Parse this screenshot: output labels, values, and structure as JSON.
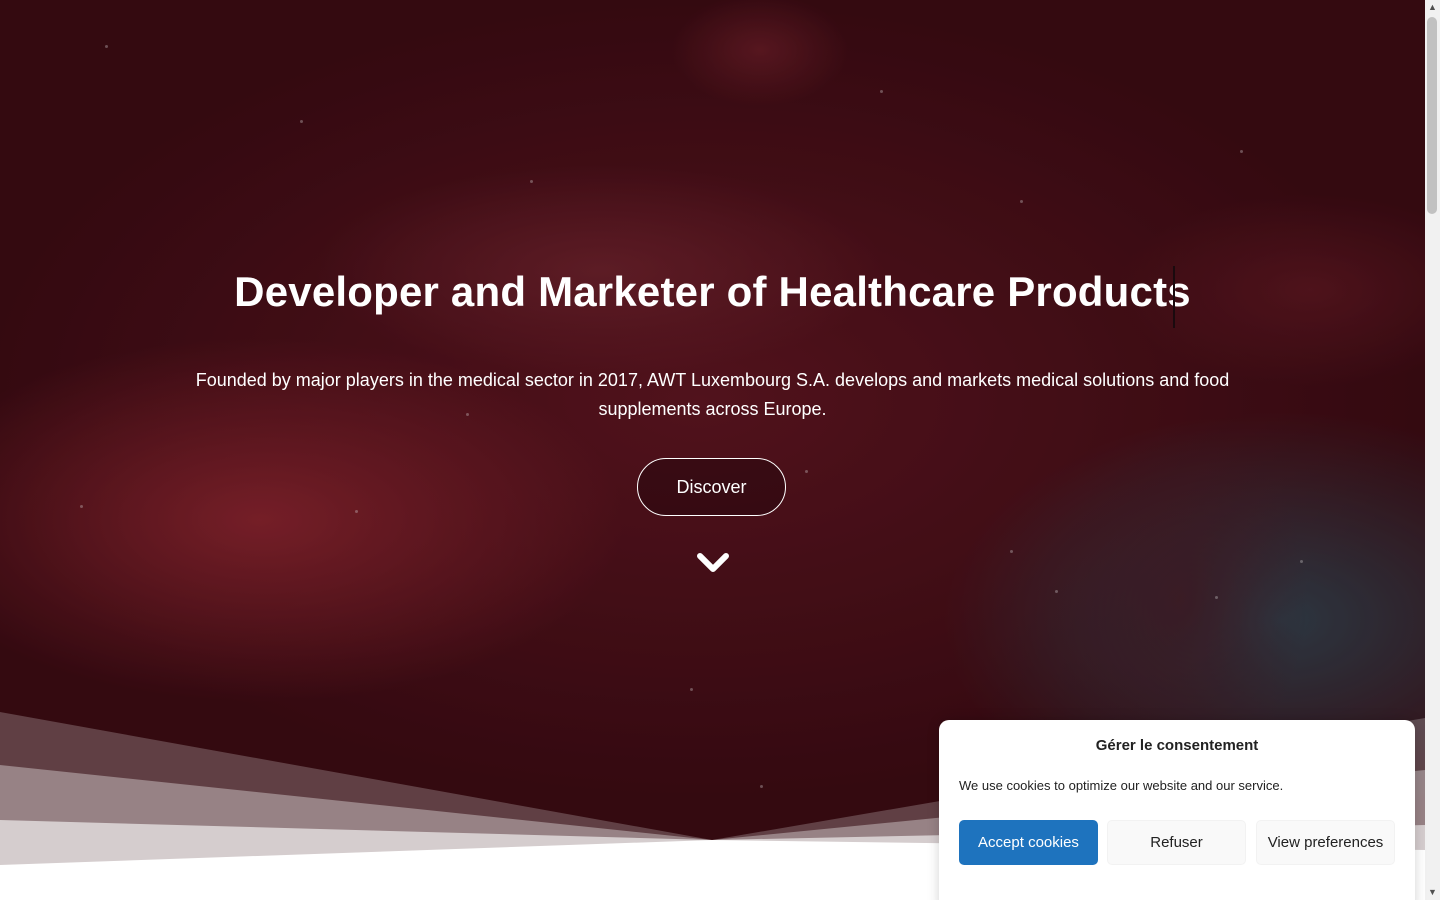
{
  "hero": {
    "title": "Developer and Marketer of Healthcare Products",
    "subtitle": "Founded by major players in the medical sector in 2017, AWT Luxembourg S.A. develops and markets medical solutions and food supplements across Europe.",
    "cta_label": "Discover",
    "scroll_icon": "chevron-down-icon"
  },
  "consent": {
    "title": "Gérer le consentement",
    "message": "We use cookies to optimize our website and our service.",
    "accept_label": "Accept cookies",
    "refuse_label": "Refuser",
    "preferences_label": "View preferences",
    "accent_color": "#1e73be"
  },
  "scrollbar": {
    "up_icon": "arrow-up-icon",
    "down_icon": "arrow-down-icon"
  }
}
